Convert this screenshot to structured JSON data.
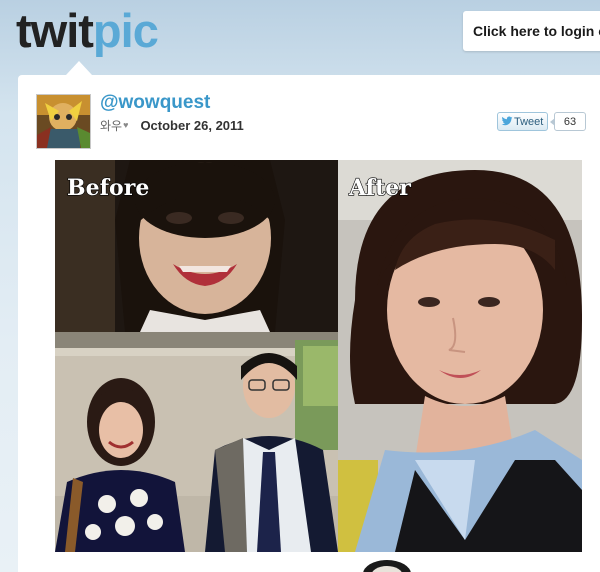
{
  "header": {
    "logo_twit": "twit",
    "logo_pic": "pic",
    "login_label": "Click here to login or sign up"
  },
  "post": {
    "username": "@wowquest",
    "display_name": "와우",
    "heart_icon": "♥",
    "date": "October 26, 2011",
    "tweet_label": "Tweet",
    "tweet_count": "63"
  },
  "photo": {
    "caption_before": "Before",
    "caption_after": "After"
  },
  "colors": {
    "brand_blue": "#5aa9d6",
    "link_blue": "#3a97c9",
    "logo_dark": "#222222"
  }
}
